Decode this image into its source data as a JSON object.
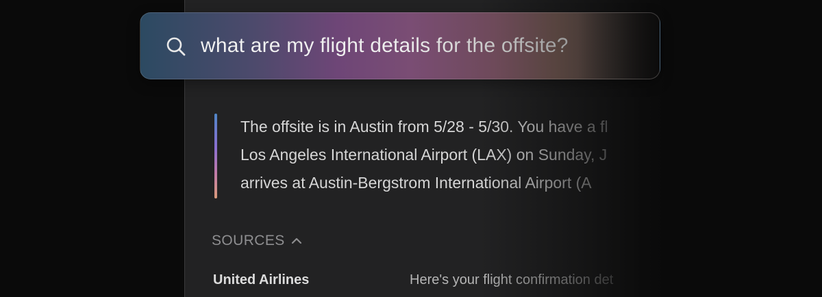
{
  "search": {
    "icon": "search-icon",
    "query": "what are my flight details for the offsite?"
  },
  "answer": {
    "lines": [
      "The offsite is in Austin from 5/28 - 5/30. You have a fl",
      "Los Angeles International Airport (LAX) on Sunday, J",
      "arrives at Austin-Bergstrom International Airport (A"
    ]
  },
  "sources": {
    "label": "SOURCES",
    "toggle_icon": "chevron-up-icon",
    "items": [
      {
        "title": "United Airlines",
        "snippet": "Here's your flight confirmation det"
      }
    ]
  },
  "colors": {
    "background": "#0a0a0a",
    "panel": "#222223",
    "answer_accent_top": "#4f86c6",
    "answer_accent_bottom": "#d99a7a"
  }
}
